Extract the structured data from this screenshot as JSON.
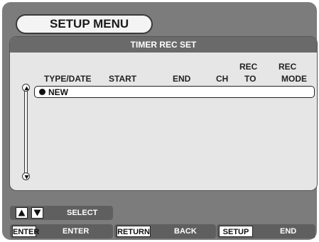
{
  "menu": {
    "title": "SETUP MENU"
  },
  "panel": {
    "title": "TIMER REC SET",
    "columns": [
      {
        "line1": "",
        "line2": "TYPE/DATE"
      },
      {
        "line1": "",
        "line2": "START"
      },
      {
        "line1": "",
        "line2": "END"
      },
      {
        "line1": "",
        "line2": "CH"
      },
      {
        "line1": "REC",
        "line2": "TO"
      },
      {
        "line1": "REC",
        "line2": "MODE"
      }
    ],
    "rows": [
      {
        "label": "NEW",
        "selected": true
      }
    ]
  },
  "icons": {
    "scroll_up": "arrow-up-circle-icon",
    "scroll_down": "arrow-down-circle-icon",
    "select_up": "triangle-up-icon",
    "select_down": "triangle-down-icon"
  },
  "footer": {
    "select": {
      "label": "SELECT"
    },
    "enter": {
      "key": "ENTER",
      "label": "ENTER"
    },
    "return": {
      "key": "RETURN",
      "label": "BACK"
    },
    "setup": {
      "key": "SETUP",
      "label": "END"
    }
  },
  "colors": {
    "screen": "#7c7c7c",
    "panel": "#e6e6e6",
    "header": "#6a6a6a",
    "footer_box": "#5f5f5f"
  }
}
